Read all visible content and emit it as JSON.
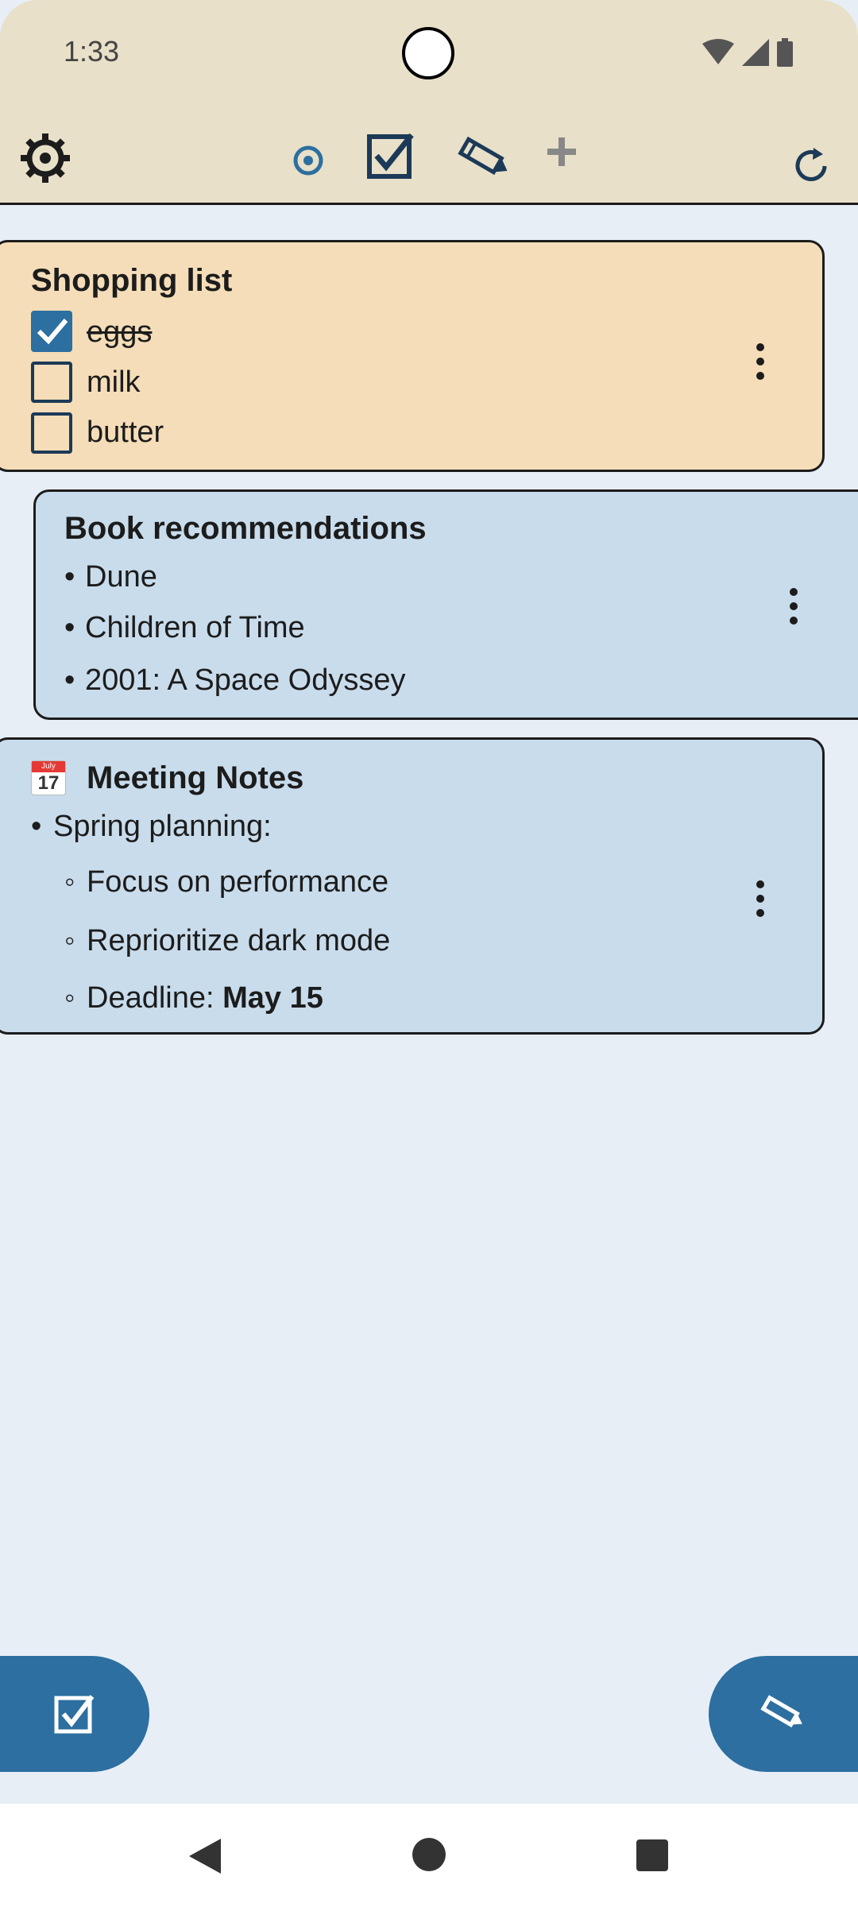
{
  "status": {
    "time": "1:33"
  },
  "toolbar": {
    "icons": [
      "settings-gear-icon",
      "target-icon",
      "checkbox-icon",
      "pencil-icon",
      "plus-icon",
      "refresh-icon"
    ]
  },
  "cards": {
    "shopping": {
      "title": "Shopping list",
      "items": [
        {
          "label": "eggs",
          "checked": true
        },
        {
          "label": "milk",
          "checked": false
        },
        {
          "label": "butter",
          "checked": false
        }
      ],
      "bg": "#f4ddb8"
    },
    "books": {
      "title": "Book recommendations",
      "items": [
        "Dune",
        "Children of Time",
        "2001: A Space Odyssey"
      ],
      "bg": "#c9dcec"
    },
    "meeting": {
      "title": "Meeting Notes",
      "calendar_month": "July",
      "calendar_day": "17",
      "section": "Spring planning:",
      "items": [
        "Focus on performance",
        "Reprioritize dark mode"
      ],
      "deadline_label": "Deadline: ",
      "deadline_value": "May 15",
      "bg": "#c9dcec"
    }
  },
  "fab": {
    "left_icon": "checkbox-icon",
    "right_icon": "pencil-icon"
  },
  "colors": {
    "accent": "#2c6fa0",
    "header_bg": "#e8e0c8",
    "page_bg": "#e8eef6"
  }
}
